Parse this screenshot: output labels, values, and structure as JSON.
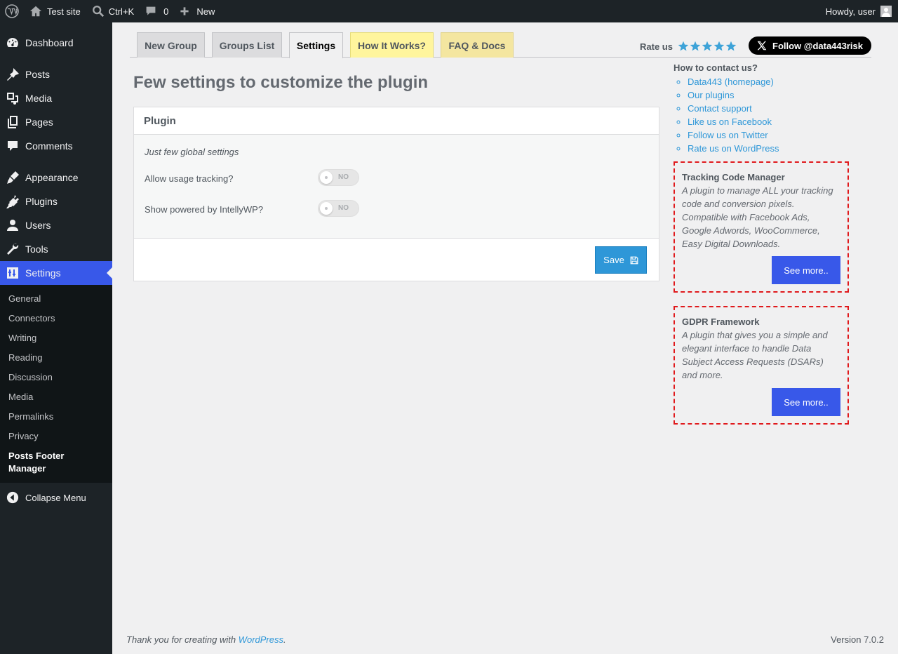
{
  "adminbar": {
    "site_name": "Test site",
    "search_shortcut": "Ctrl+K",
    "comments_count": "0",
    "new_label": "New",
    "howdy": "Howdy, user"
  },
  "sidebar": {
    "items": [
      {
        "label": "Dashboard",
        "icon": "dashboard-icon"
      },
      {
        "label": "Posts",
        "icon": "pin-icon"
      },
      {
        "label": "Media",
        "icon": "media-icon"
      },
      {
        "label": "Pages",
        "icon": "pages-icon"
      },
      {
        "label": "Comments",
        "icon": "comment-icon"
      },
      {
        "label": "Appearance",
        "icon": "brush-icon"
      },
      {
        "label": "Plugins",
        "icon": "plug-icon"
      },
      {
        "label": "Users",
        "icon": "user-icon"
      },
      {
        "label": "Tools",
        "icon": "wrench-icon"
      },
      {
        "label": "Settings",
        "icon": "sliders-icon"
      }
    ],
    "submenu": [
      "General",
      "Connectors",
      "Writing",
      "Reading",
      "Discussion",
      "Media",
      "Permalinks",
      "Privacy",
      "Posts Footer Manager"
    ],
    "collapse": "Collapse Menu"
  },
  "tabs": [
    "New Group",
    "Groups List",
    "Settings",
    "How It Works?",
    "FAQ & Docs"
  ],
  "rate_label": "Rate us",
  "follow_label": "Follow @data443risk",
  "page_title": "Few settings to customize the plugin",
  "panel": {
    "title": "Plugin",
    "description": "Just few global settings",
    "rows": [
      {
        "label": "Allow usage tracking?",
        "state": "NO"
      },
      {
        "label": "Show powered by IntellyWP?",
        "state": "NO"
      }
    ],
    "save_label": "Save"
  },
  "contact": {
    "title": "How to contact us?",
    "links": [
      "Data443 (homepage)",
      "Our plugins",
      "Contact support",
      "Like us on Facebook",
      "Follow us on Twitter",
      "Rate us on WordPress"
    ]
  },
  "promos": [
    {
      "title": "Tracking Code Manager",
      "description": "A plugin to manage ALL your tracking code and conversion pixels. Compatible with Facebook Ads, Google Adwords, WooCommerce, Easy Digital Downloads.",
      "button": "See more.."
    },
    {
      "title": "GDPR Framework",
      "description": "A plugin that gives you a simple and elegant interface to handle Data Subject Access Requests (DSARs) and more.",
      "button": "See more.."
    }
  ],
  "footer": {
    "thanks_prefix": "Thank you for creating with ",
    "thanks_link": "WordPress",
    "thanks_suffix": ".",
    "version": "Version 7.0.2"
  },
  "colors": {
    "accent": "#3858e9",
    "link": "#2e97d8",
    "promo_border": "#e0191c"
  }
}
